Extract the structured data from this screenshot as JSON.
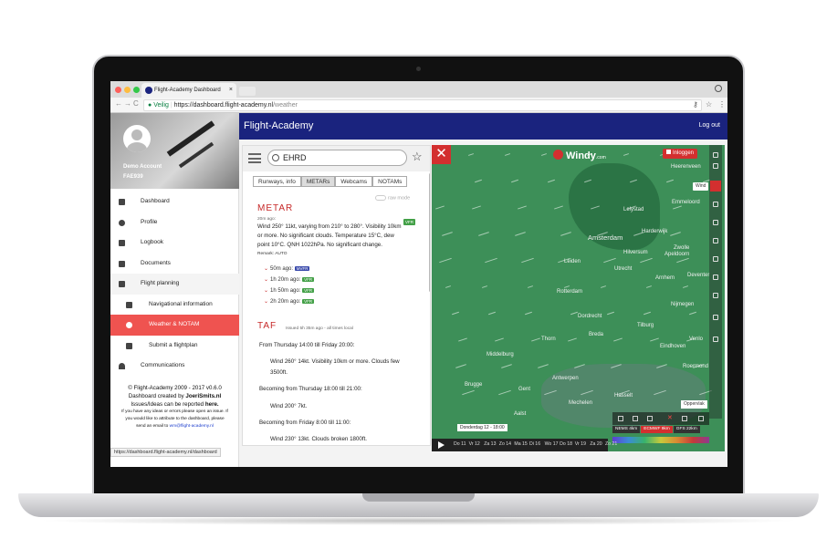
{
  "browser": {
    "tab_title": "Flight-Academy Dashboard",
    "tab_close": "×",
    "secure_label": "Veilig",
    "url_host": "https://dashboard.flight-academy.nl",
    "url_path": "/weather",
    "back": "←",
    "forward": "→",
    "reload": "C",
    "key_icon": "⚷",
    "star_icon": "☆",
    "menu_icon": "⋮",
    "status_url": "https://dashboard.flight-academy.nl/dashboard"
  },
  "header": {
    "brand": "Flight-Academy",
    "logout": "Log out"
  },
  "user": {
    "name": "Demo Account",
    "code": "FAE939"
  },
  "sidebar": {
    "items": [
      {
        "label": "Dashboard",
        "icon": "dashboard-icon"
      },
      {
        "label": "Profile",
        "icon": "profile-icon"
      },
      {
        "label": "Logbook",
        "icon": "logbook-icon"
      },
      {
        "label": "Documents",
        "icon": "documents-icon"
      },
      {
        "label": "Flight planning",
        "icon": "plane-icon"
      },
      {
        "label": "Navigational information",
        "icon": "navigation-icon"
      },
      {
        "label": "Weather & NOTAM",
        "icon": "sun-icon"
      },
      {
        "label": "Submit a flightplan",
        "icon": "flightplan-icon"
      },
      {
        "label": "Communications",
        "icon": "headset-icon"
      }
    ]
  },
  "credits": {
    "line1": "© Flight-Academy 2009 - 2017 v0.6.0",
    "line2a": "Dashboard created by ",
    "line2b": "JoeriSmits.nl",
    "line3a": "Issues/Ideas can be reported ",
    "line3b": "here.",
    "small1": "If you have any ideas or errors please open an issue. If",
    "small2": "you would like to attribute to the dashboard, please",
    "small3a": "send an email to ",
    "small3b": "wm@flight-academy.nl"
  },
  "panel": {
    "search_value": "EHRD",
    "tabs": [
      "Runways, info",
      "METARs",
      "Webcams",
      "NOTAMs"
    ],
    "raw_mode": "raw mode",
    "metar_title": "METAR",
    "metar_ago": "20m ago:",
    "metar_text": "Wind 250° 11kt, varying from 210° to 280°. Visibility 10km or more. No significant clouds. Temperature 15°C, dew point 10°C. QNH 1022hPa. No significant change.",
    "metar_remark": "Remark: AUTO",
    "metar_badge": "VFR",
    "history": [
      {
        "label": "50m ago:",
        "badge": "MVFR"
      },
      {
        "label": "1h 20m ago:",
        "badge": "VFR"
      },
      {
        "label": "1h 50m ago:",
        "badge": "VFR"
      },
      {
        "label": "2h 20m ago:",
        "badge": "VFR"
      }
    ],
    "taf_title": "TAF",
    "taf_issued": "Issued 5h 35m ago - all times local",
    "taf_lines": [
      "From Thursday 14:00 till Friday 20:00:",
      "Wind 260° 14kt. Visibility 10km or more. Clouds few",
      "3500ft.",
      "Becoming from Thursday 18:00 till 21:00:",
      "Wind 200° 7kt.",
      "Becoming from Friday 8:00 till 11:00:",
      "Wind 230° 13kt. Clouds broken 1800ft."
    ]
  },
  "map": {
    "close": "✕",
    "brand": "Windy",
    "brand_suffix": ".com",
    "login": "Inloggen",
    "layer_wind": "Wind",
    "surface": "Oppervlak",
    "date_label": "Donderdag 12 - 18:00",
    "days": [
      "Do 11",
      "Vr 12",
      "Za 13",
      "Zo 14",
      "Ma 15",
      "Di 16",
      "Wo 17",
      "Do 18",
      "Vr 19",
      "Za 20",
      "Zo 21"
    ],
    "models": [
      "NEMS 4km",
      "ECMWF 9km",
      "GFS 22km"
    ],
    "cities": [
      {
        "name": "Heerenveen"
      },
      {
        "name": "Emmeloord"
      },
      {
        "name": "Zwolle"
      },
      {
        "name": "Amsterdam",
        "big": true
      },
      {
        "name": "Hilversum"
      },
      {
        "name": "Apeldoorn"
      },
      {
        "name": "Leiden"
      },
      {
        "name": "Utrecht"
      },
      {
        "name": "Arnhem"
      },
      {
        "name": "Rotterdam"
      },
      {
        "name": "Nijmegen"
      },
      {
        "name": "Breda"
      },
      {
        "name": "Tilburg"
      },
      {
        "name": "Eindhoven"
      },
      {
        "name": "Middelburg"
      },
      {
        "name": "Brugge"
      },
      {
        "name": "Antwerpen"
      },
      {
        "name": "Gent"
      },
      {
        "name": "Venlo"
      },
      {
        "name": "Roermond"
      },
      {
        "name": "Thorn"
      },
      {
        "name": "Lelystad"
      },
      {
        "name": "Harderwijk"
      },
      {
        "name": "Deventer"
      },
      {
        "name": "Dordrecht"
      },
      {
        "name": "Hasselt"
      },
      {
        "name": "Mechelen"
      },
      {
        "name": "Aalst"
      }
    ]
  }
}
